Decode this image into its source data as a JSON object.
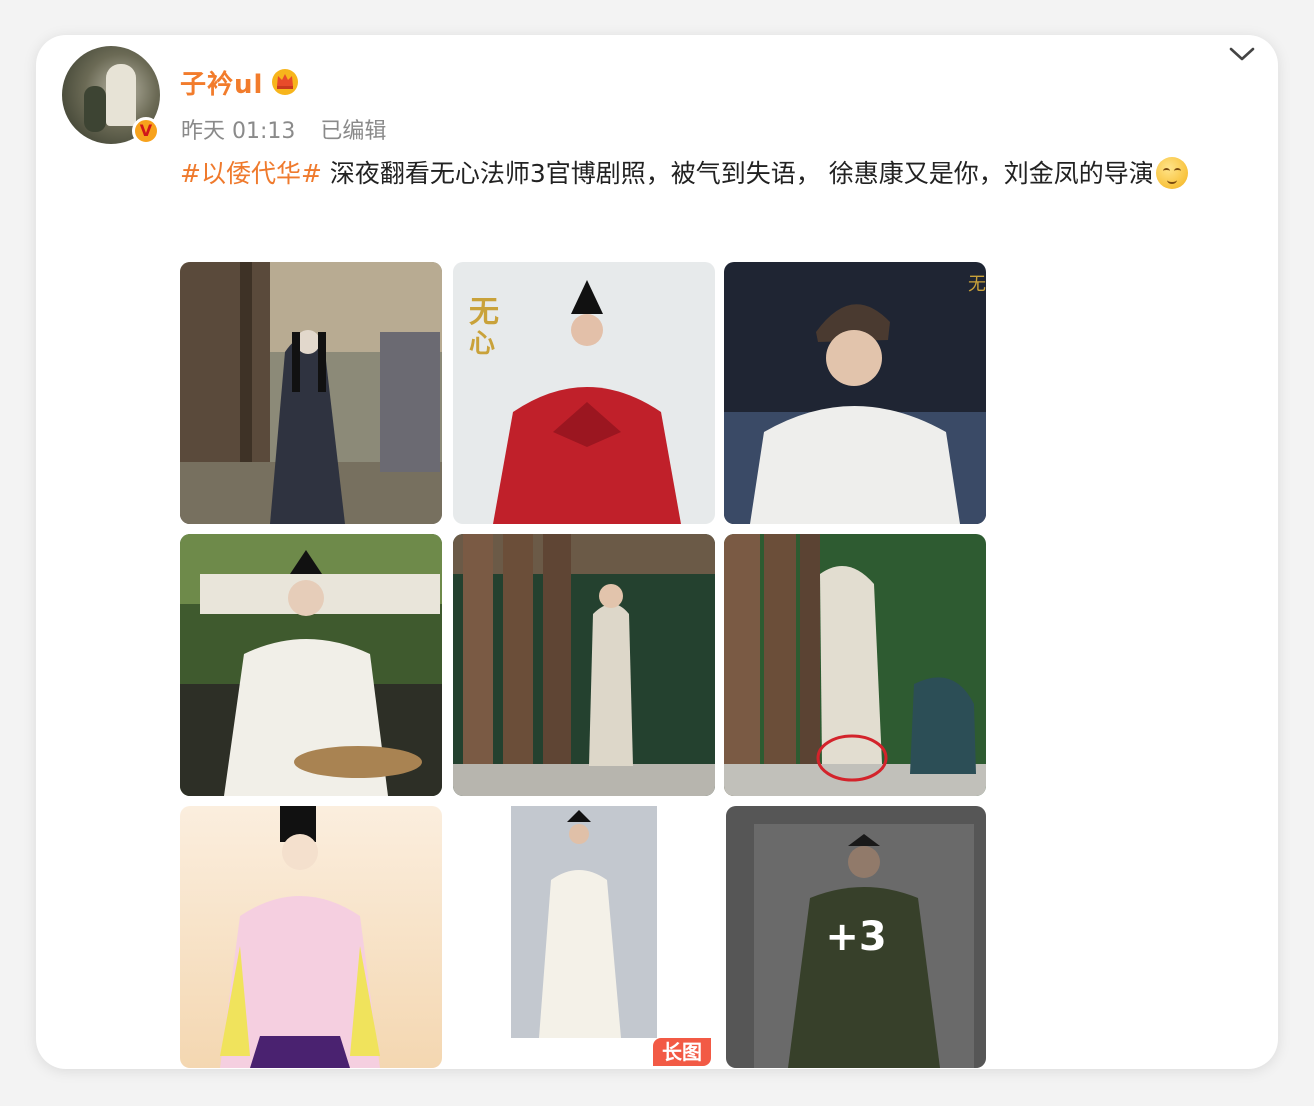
{
  "post": {
    "username": "子衿ul",
    "verified_badge": "V",
    "crown_icon": "crown-icon",
    "timestamp": "昨天 01:13",
    "edited_label": "已编辑",
    "hashtag": "#以倭代华#",
    "body_text": " 深夜翻看无心法师3官博剧照，被气到失语， 徐惠康又是你，刘金凤的导演",
    "emoji_icon": "speechless-face-icon",
    "more_icon": "chevron-down-icon"
  },
  "images": {
    "count_visible": 9,
    "more_overlay_label": "+3",
    "long_image_badge": "长图",
    "tiles": [
      {
        "name": "photo-street-scene",
        "icon": "photo"
      },
      {
        "name": "photo-red-robe",
        "icon": "photo"
      },
      {
        "name": "photo-white-robe",
        "icon": "photo"
      },
      {
        "name": "photo-basket",
        "icon": "photo"
      },
      {
        "name": "photo-veranda",
        "icon": "photo"
      },
      {
        "name": "photo-veranda-circled",
        "icon": "photo"
      },
      {
        "name": "illustration-pink-robe",
        "icon": "illustration"
      },
      {
        "name": "photo-white-costume",
        "icon": "photo"
      },
      {
        "name": "photo-green-robe",
        "icon": "photo"
      }
    ]
  },
  "colors": {
    "accent": "#f27c2c",
    "hashtag": "#ef7a2d",
    "meta_gray": "#8a8a8a",
    "badge_red": "#f25a45"
  }
}
